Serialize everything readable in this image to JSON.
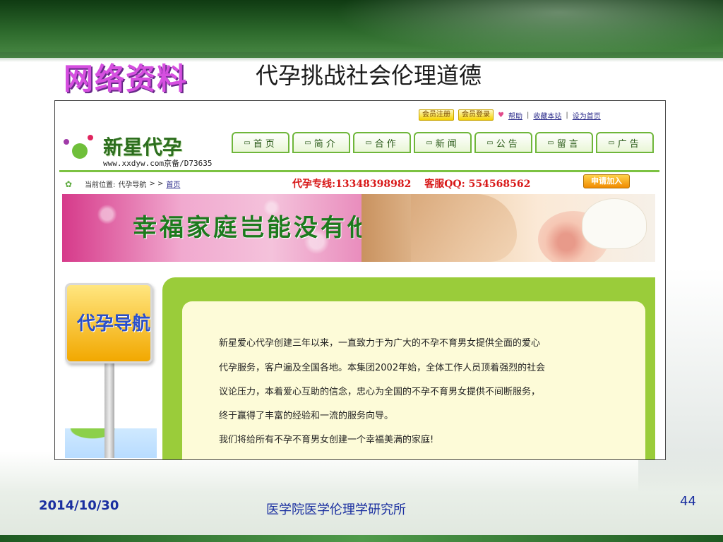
{
  "slide": {
    "wordart": "网络资料",
    "title": "代孕挑战社会伦理道德",
    "footer_date": "2014/10/30",
    "footer_org": "医学院医学伦理学研究所",
    "page_number": "44"
  },
  "website": {
    "member_register": "会员注册",
    "member_login": "会员登录",
    "help": "帮助",
    "favorite": "收藏本站",
    "set_home": "设为首页",
    "logo_text": "新星代孕",
    "logo_url": "www.xxdyw.com京备/D73635",
    "nav": [
      "首页",
      "简介",
      "合作",
      "新闻",
      "公告",
      "留言",
      "广告"
    ],
    "breadcrumb_prefix": "当前位置:",
    "breadcrumb_section": "代孕导航",
    "breadcrumb_arrows": "> >",
    "breadcrumb_home": "首页",
    "hotline": "代孕专线:13348398982",
    "qq": "客服QQ: 554568562",
    "apply_button": "申请加入",
    "banner_slogan": "幸福家庭岂能没有他",
    "sign_text": "代孕导航",
    "body_lines": [
      "新星爱心代孕创建三年以来，一直致力于为广大的不孕不育男女提供全面的爱心",
      "代孕服务，客户遍及全国各地。本集团2002年始，全体工作人员顶着强烈的社会",
      "议论压力，本着爱心互助的信念，忠心为全国的不孕不育男女提供不间断服务，",
      "终于赢得了丰富的经验和一流的服务向导。",
      "我们将给所有不孕不育男女创建一个幸福美满的家庭!"
    ]
  },
  "colors": {
    "brand_green": "#7cc242",
    "footer_blue": "#1a2fa0",
    "hotline_red": "#d81818",
    "wordart_purple": "#d64fe0"
  }
}
